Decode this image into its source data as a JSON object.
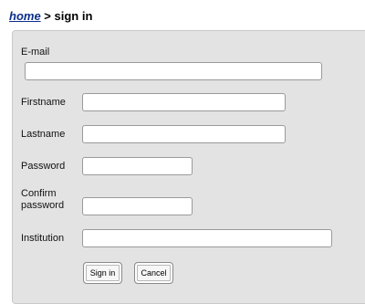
{
  "breadcrumb": {
    "home_link": "home",
    "separator": " > ",
    "current": "sign in"
  },
  "form": {
    "email": {
      "label": "E-mail",
      "value": ""
    },
    "firstname": {
      "label": "Firstname",
      "value": ""
    },
    "lastname": {
      "label": "Lastname",
      "value": ""
    },
    "password": {
      "label": "Password",
      "value": ""
    },
    "confirm_password": {
      "label_line1": "Confirm",
      "label_line2": "password",
      "value": ""
    },
    "institution": {
      "label": "Institution",
      "value": ""
    },
    "signin_label": "Sign in",
    "cancel_label": "Cancel"
  }
}
